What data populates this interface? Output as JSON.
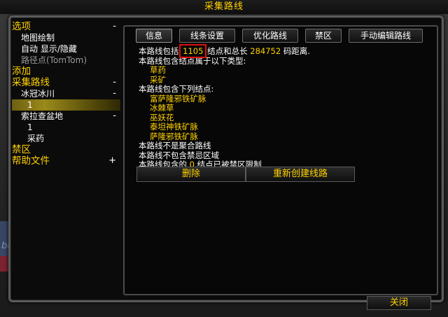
{
  "window": {
    "title": "采集路线"
  },
  "sidebar": {
    "sections": [
      {
        "label": "选项",
        "toggle": "-",
        "items": [
          {
            "label": "地图绘制"
          },
          {
            "label": "自动 显示/隐藏"
          },
          {
            "label": "路径点(TomTom)",
            "dim": true
          }
        ]
      },
      {
        "label": "添加",
        "toggle": "",
        "items": []
      },
      {
        "label": "采集路线",
        "toggle": "-",
        "items": [
          {
            "label": "冰冠冰川",
            "toggle": "-"
          },
          {
            "label": "1",
            "sub": true,
            "selected": true
          },
          {
            "label": "索拉查盆地",
            "toggle": "-"
          },
          {
            "label": "1",
            "sub": true
          },
          {
            "label": "采药",
            "sub": true
          }
        ]
      },
      {
        "label": "禁区",
        "toggle": "",
        "items": []
      },
      {
        "label": "帮助文件",
        "toggle": "+",
        "items": []
      }
    ]
  },
  "tabs": [
    {
      "label": "信息",
      "active": true
    },
    {
      "label": "线条设置"
    },
    {
      "label": "优化路线"
    },
    {
      "label": "禁区"
    },
    {
      "label": "手动编辑路线"
    }
  ],
  "info": {
    "summary_prefix": "本路线包括",
    "node_count": "1105",
    "summary_mid": "结点和总长",
    "total_length": "284752",
    "summary_suffix": "码距离.",
    "types_heading": "本路线包含结点属于以下类型:",
    "types": [
      "草药",
      "采矿"
    ],
    "nodes_heading": "本路线包含下列结点:",
    "nodes": [
      "富萨隆邪铁矿脉",
      "冰棘草",
      "巫妖花",
      "泰坦神铁矿脉",
      "萨隆邪铁矿脉"
    ],
    "not_merged": "本路线不是聚合路线",
    "no_forbidden": "本路线不包含禁忌区域",
    "restricted_prefix": "本路线包含的",
    "restricted_count": "0",
    "restricted_suffix": "结点已被禁区限制"
  },
  "actions": {
    "delete_label": "删除",
    "recreate_label": "重新创建线路"
  },
  "footer": {
    "close_label": "关闭"
  },
  "background": {
    "player_name": "buoker"
  },
  "colors": {
    "accent_gold": "#ffd100",
    "highlight_red": "#e01010",
    "selection": "#9a8a1a"
  }
}
